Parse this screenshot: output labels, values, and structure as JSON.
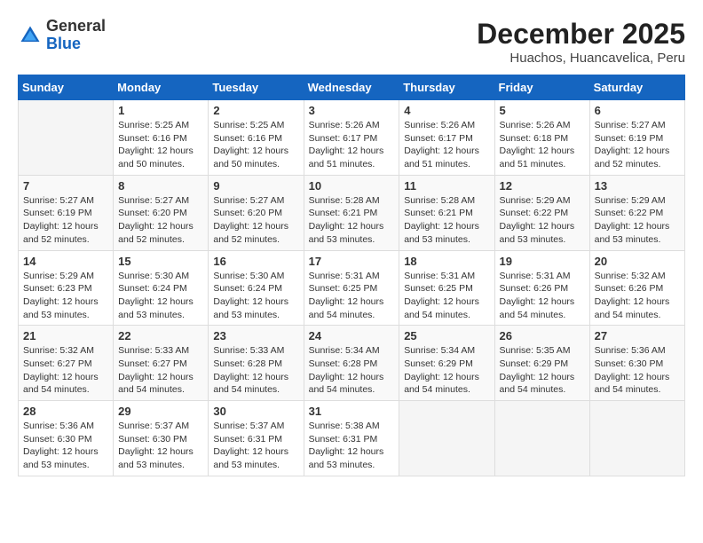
{
  "header": {
    "logo": {
      "general": "General",
      "blue": "Blue"
    },
    "title": "December 2025",
    "subtitle": "Huachos, Huancavelica, Peru"
  },
  "calendar": {
    "days_of_week": [
      "Sunday",
      "Monday",
      "Tuesday",
      "Wednesday",
      "Thursday",
      "Friday",
      "Saturday"
    ],
    "weeks": [
      [
        {
          "day": "",
          "info": ""
        },
        {
          "day": "1",
          "info": "Sunrise: 5:25 AM\nSunset: 6:16 PM\nDaylight: 12 hours\nand 50 minutes."
        },
        {
          "day": "2",
          "info": "Sunrise: 5:25 AM\nSunset: 6:16 PM\nDaylight: 12 hours\nand 50 minutes."
        },
        {
          "day": "3",
          "info": "Sunrise: 5:26 AM\nSunset: 6:17 PM\nDaylight: 12 hours\nand 51 minutes."
        },
        {
          "day": "4",
          "info": "Sunrise: 5:26 AM\nSunset: 6:17 PM\nDaylight: 12 hours\nand 51 minutes."
        },
        {
          "day": "5",
          "info": "Sunrise: 5:26 AM\nSunset: 6:18 PM\nDaylight: 12 hours\nand 51 minutes."
        },
        {
          "day": "6",
          "info": "Sunrise: 5:27 AM\nSunset: 6:19 PM\nDaylight: 12 hours\nand 52 minutes."
        }
      ],
      [
        {
          "day": "7",
          "info": "Sunrise: 5:27 AM\nSunset: 6:19 PM\nDaylight: 12 hours\nand 52 minutes."
        },
        {
          "day": "8",
          "info": "Sunrise: 5:27 AM\nSunset: 6:20 PM\nDaylight: 12 hours\nand 52 minutes."
        },
        {
          "day": "9",
          "info": "Sunrise: 5:27 AM\nSunset: 6:20 PM\nDaylight: 12 hours\nand 52 minutes."
        },
        {
          "day": "10",
          "info": "Sunrise: 5:28 AM\nSunset: 6:21 PM\nDaylight: 12 hours\nand 53 minutes."
        },
        {
          "day": "11",
          "info": "Sunrise: 5:28 AM\nSunset: 6:21 PM\nDaylight: 12 hours\nand 53 minutes."
        },
        {
          "day": "12",
          "info": "Sunrise: 5:29 AM\nSunset: 6:22 PM\nDaylight: 12 hours\nand 53 minutes."
        },
        {
          "day": "13",
          "info": "Sunrise: 5:29 AM\nSunset: 6:22 PM\nDaylight: 12 hours\nand 53 minutes."
        }
      ],
      [
        {
          "day": "14",
          "info": "Sunrise: 5:29 AM\nSunset: 6:23 PM\nDaylight: 12 hours\nand 53 minutes."
        },
        {
          "day": "15",
          "info": "Sunrise: 5:30 AM\nSunset: 6:24 PM\nDaylight: 12 hours\nand 53 minutes."
        },
        {
          "day": "16",
          "info": "Sunrise: 5:30 AM\nSunset: 6:24 PM\nDaylight: 12 hours\nand 53 minutes."
        },
        {
          "day": "17",
          "info": "Sunrise: 5:31 AM\nSunset: 6:25 PM\nDaylight: 12 hours\nand 54 minutes."
        },
        {
          "day": "18",
          "info": "Sunrise: 5:31 AM\nSunset: 6:25 PM\nDaylight: 12 hours\nand 54 minutes."
        },
        {
          "day": "19",
          "info": "Sunrise: 5:31 AM\nSunset: 6:26 PM\nDaylight: 12 hours\nand 54 minutes."
        },
        {
          "day": "20",
          "info": "Sunrise: 5:32 AM\nSunset: 6:26 PM\nDaylight: 12 hours\nand 54 minutes."
        }
      ],
      [
        {
          "day": "21",
          "info": "Sunrise: 5:32 AM\nSunset: 6:27 PM\nDaylight: 12 hours\nand 54 minutes."
        },
        {
          "day": "22",
          "info": "Sunrise: 5:33 AM\nSunset: 6:27 PM\nDaylight: 12 hours\nand 54 minutes."
        },
        {
          "day": "23",
          "info": "Sunrise: 5:33 AM\nSunset: 6:28 PM\nDaylight: 12 hours\nand 54 minutes."
        },
        {
          "day": "24",
          "info": "Sunrise: 5:34 AM\nSunset: 6:28 PM\nDaylight: 12 hours\nand 54 minutes."
        },
        {
          "day": "25",
          "info": "Sunrise: 5:34 AM\nSunset: 6:29 PM\nDaylight: 12 hours\nand 54 minutes."
        },
        {
          "day": "26",
          "info": "Sunrise: 5:35 AM\nSunset: 6:29 PM\nDaylight: 12 hours\nand 54 minutes."
        },
        {
          "day": "27",
          "info": "Sunrise: 5:36 AM\nSunset: 6:30 PM\nDaylight: 12 hours\nand 54 minutes."
        }
      ],
      [
        {
          "day": "28",
          "info": "Sunrise: 5:36 AM\nSunset: 6:30 PM\nDaylight: 12 hours\nand 53 minutes."
        },
        {
          "day": "29",
          "info": "Sunrise: 5:37 AM\nSunset: 6:30 PM\nDaylight: 12 hours\nand 53 minutes."
        },
        {
          "day": "30",
          "info": "Sunrise: 5:37 AM\nSunset: 6:31 PM\nDaylight: 12 hours\nand 53 minutes."
        },
        {
          "day": "31",
          "info": "Sunrise: 5:38 AM\nSunset: 6:31 PM\nDaylight: 12 hours\nand 53 minutes."
        },
        {
          "day": "",
          "info": ""
        },
        {
          "day": "",
          "info": ""
        },
        {
          "day": "",
          "info": ""
        }
      ]
    ]
  }
}
